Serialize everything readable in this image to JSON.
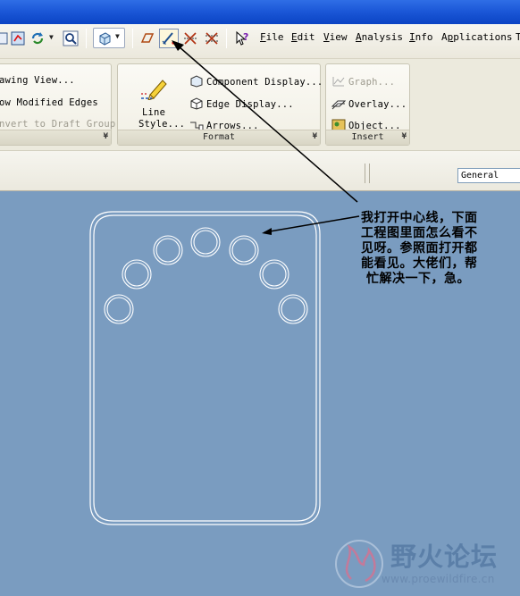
{
  "menu": {
    "file": "File",
    "file_u": "F",
    "edit": "Edit",
    "edit_u": "E",
    "view": "View",
    "view_u": "V",
    "analysis": "Analysis",
    "analysis_u": "A",
    "info": "Info",
    "info_u": "I",
    "applications": "Applications",
    "applications_u": "p",
    "truncated": "T"
  },
  "ribbon": {
    "left_group": {
      "drawing_view": "awing View...",
      "modified_edges": "ow Modified Edges",
      "convert_draft": "nvert to Draft Group"
    },
    "format_group": {
      "line_style_1": "Line",
      "line_style_2": "Style...",
      "component_display": "Component Display...",
      "edge_display": "Edge Display...",
      "arrows": "Arrows...",
      "footer": "Format"
    },
    "insert_group": {
      "graph": "Graph...",
      "overlay": "Overlay...",
      "object": "Object...",
      "footer": "Insert"
    }
  },
  "filter": {
    "selected": "General"
  },
  "annotation": {
    "line1": "我打开中心线，下面",
    "line2": "工程图里面怎么看不",
    "line3": "见呀。参照面打开都",
    "line4": "能看见。大佬们，帮",
    "line5": "忙解决一下，急。"
  },
  "watermark": {
    "text": "野火论坛",
    "url": "www.proewildfire.cn"
  },
  "colors": {
    "canvas": "#7a9cc0",
    "drawing_lines": "#ffffff",
    "titlebar": "#1a56d6"
  },
  "icons": [
    "refresh-icon",
    "zoom-icon",
    "view-cube-icon",
    "datum-display-icon",
    "centerline-display-icon",
    "axis-display-icon",
    "help-icon",
    "line-style-pencil-icon"
  ]
}
